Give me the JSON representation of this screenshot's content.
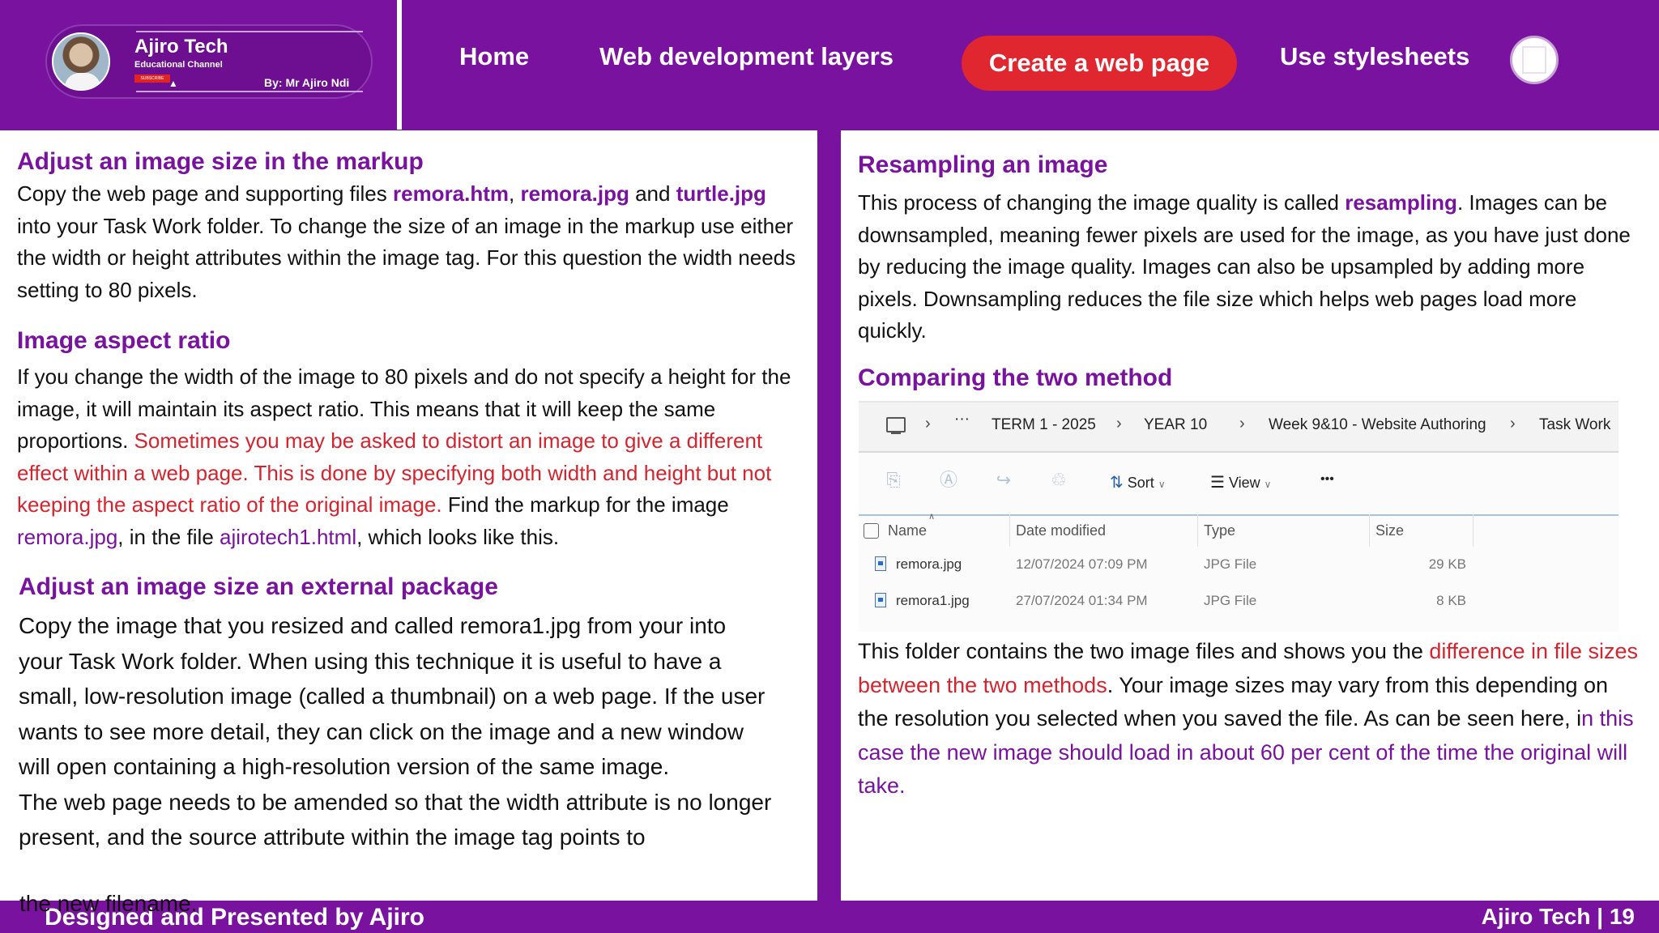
{
  "logo": {
    "name": "Ajiro Tech",
    "subtitle": "Educational Channel",
    "subscribe": "SUBSCRIBE",
    "byline": "By: Mr Ajiro Ndi"
  },
  "nav": {
    "items": [
      "Home",
      "Web development layers",
      "Create a web page",
      "Use stylesheets"
    ],
    "active": "Create a web page"
  },
  "left": {
    "s1_heading": "Adjust an image size in the markup",
    "s1_a": "Copy the web page and supporting files ",
    "s1_f1": "remora.htm",
    "s1_c1": ", ",
    "s1_f2": "remora.jpg",
    "s1_and": " and ",
    "s1_f3": "turtle.jpg",
    "s1_b": "into your Task Work folder. To change the size of an image in the markup use either the width or height attributes within the image tag. For this question the width needs setting to 80 pixels.",
    "s2_heading": "Image aspect ratio",
    "s2_a": "If you change the width of the image to 80 pixels and do not specify a height for the image, it will maintain its aspect ratio. This means that it will keep the same proportions. ",
    "s2_red": "Sometimes you may be asked to distort an image to give a different effect within a web page. This is done by specifying both width and height but not keeping the aspect ratio of the original image.",
    "s2_b": " Find the markup for the image ",
    "s2_f1": "remora.jpg",
    "s2_c": ", in the file ",
    "s2_f2": "ajirotech1.html",
    "s2_d": ", which looks like this.",
    "s3_heading": "Adjust an image size an external package",
    "s3_a": "Copy the image that you resized and called remora1.jpg from your into your Task Work folder. When using this technique it is useful to have a small, low-resolution image (called a thumbnail) on a web page. If the user wants to see more detail, they can click on the image and a new window will open containing a high-resolution version of the same image.",
    "s3_b": "The web page needs to be amended so that the width attribute is no longer present, and the source attribute within the image tag points to",
    "s3_overflow": "the new filename."
  },
  "right": {
    "r1_heading": "Resampling an image",
    "r1_a": "This process of changing the image quality is called ",
    "r1_hl": "resampling",
    "r1_b": ". Images can be downsampled, meaning fewer pixels are used for the image, as you have just done by reducing the image quality. Images can also be upsampled by adding more pixels. Downsampling reduces the file size which helps web pages load more quickly.",
    "r2_heading": "Comparing the two method",
    "r3_a": "This folder contains the two image files and shows you the ",
    "r3_red": "difference in file sizes between the two methods",
    "r3_b": ". Your image sizes may vary from this depending on the resolution you selected when you saved the file. As can be seen here, i",
    "r3_purple": "n this case the new image should load in about 60 per cent of the time the original will take."
  },
  "explorer": {
    "ellipsis": "···",
    "breadcrumbs": [
      "TERM 1 - 2025",
      "YEAR 10",
      "Week 9&10 - Website Authoring",
      "Task Work"
    ],
    "toolbar": {
      "sort": "Sort",
      "view": "View",
      "more": "•••"
    },
    "columns": [
      "Name",
      "Date modified",
      "Type",
      "Size"
    ],
    "files": [
      {
        "name": "remora.jpg",
        "date": "12/07/2024 07:09 PM",
        "type": "JPG File",
        "size": "29 KB"
      },
      {
        "name": "remora1.jpg",
        "date": "27/07/2024 01:34 PM",
        "type": "JPG File",
        "size": "8 KB"
      }
    ]
  },
  "footer": {
    "left": "Designed and Presented by Ajiro",
    "right": "Ajiro Tech | 19"
  },
  "colors": {
    "accent": "#7a12a0",
    "highlight": "#d6242e",
    "active_nav": "#e0262e"
  }
}
